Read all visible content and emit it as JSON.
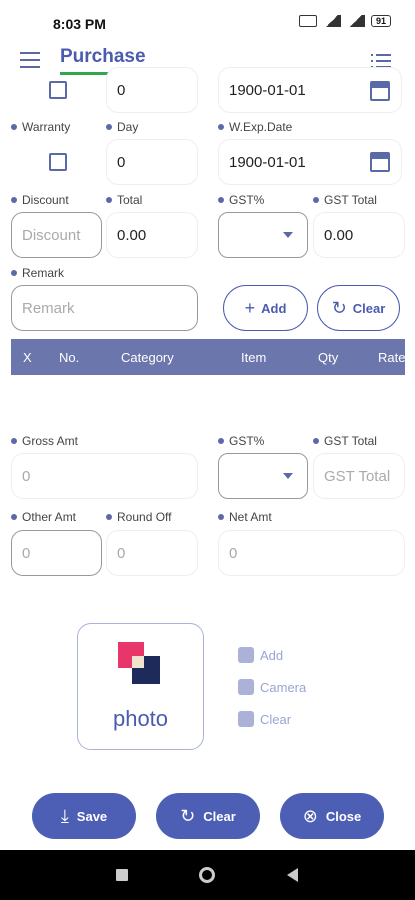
{
  "status": {
    "time": "8:03 PM",
    "battery": "91"
  },
  "appbar": {
    "title": "Purchase"
  },
  "row_top": {
    "day_value": "0",
    "date_value": "1900-01-01"
  },
  "warranty": {
    "warranty_label": "Warranty",
    "day_label": "Day",
    "wexp_label": "W.Exp.Date",
    "day_value": "0",
    "date_value": "1900-01-01"
  },
  "discount_row": {
    "discount_label": "Discount",
    "total_label": "Total",
    "gst_label": "GST%",
    "gst_total_label": "GST Total",
    "discount_placeholder": "Discount",
    "total_value": "0.00",
    "gst_total_value": "0.00"
  },
  "remark": {
    "label": "Remark",
    "placeholder": "Remark",
    "add_label": "Add",
    "clear_label": "Clear"
  },
  "table": {
    "headers": [
      "X",
      "No.",
      "Category",
      "Item",
      "Qty",
      "Rate"
    ]
  },
  "gross_row": {
    "gross_label": "Gross Amt",
    "gst_label": "GST%",
    "gst_total_label": "GST Total",
    "gross_value": "0",
    "gst_total_placeholder": "GST Total"
  },
  "other_row": {
    "other_label": "Other Amt",
    "round_label": "Round Off",
    "net_label": "Net Amt",
    "other_value": "0",
    "round_value": "0",
    "net_value": "0"
  },
  "photo": {
    "text": "photo",
    "add": "Add",
    "camera": "Camera",
    "clear": "Clear"
  },
  "buttons": {
    "save": "Save",
    "clear": "Clear",
    "close": "Close"
  },
  "colors": {
    "primary": "#4d5eb5",
    "accent_underline": "#2ea84a",
    "table_header": "#6b76ac"
  }
}
